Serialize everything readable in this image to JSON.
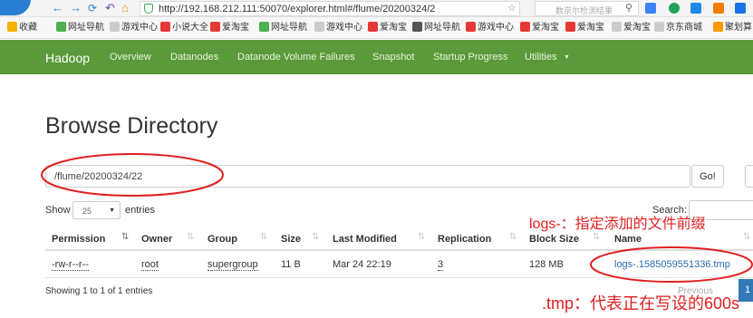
{
  "browser": {
    "url": "http://192.168.212.111:50070/explorer.html#/flume/20200324/2",
    "url_host": "192.168.212.111",
    "search_placeholder": "数京尔检测结果"
  },
  "bookmarks": [
    {
      "label": "收藏",
      "color": "#f5b400"
    },
    {
      "label": "网址导航",
      "color": "#4caf50"
    },
    {
      "label": "游戏中心",
      "color": "#cccccc"
    },
    {
      "label": "小说大全",
      "color": "#e53935"
    },
    {
      "label": "爱淘宝",
      "color": "#e53935"
    },
    {
      "label": "网址导航",
      "color": "#4caf50"
    },
    {
      "label": "游戏中心",
      "color": "#cccccc"
    },
    {
      "label": "爱淘宝",
      "color": "#e53935"
    },
    {
      "label": "网址导航",
      "color": "#555555"
    },
    {
      "label": "游戏中心",
      "color": "#e53935"
    },
    {
      "label": "爱淘宝",
      "color": "#e53935"
    },
    {
      "label": "爱淘宝",
      "color": "#e53935"
    },
    {
      "label": "爱淘宝",
      "color": "#cccccc"
    },
    {
      "label": "京东商城",
      "color": "#cccccc"
    },
    {
      "label": "聚划算",
      "color": "#ff9800"
    }
  ],
  "navbar": {
    "brand": "Hadoop",
    "items": [
      "Overview",
      "Datanodes",
      "Datanode Volume Failures",
      "Snapshot",
      "Startup Progress",
      "Utilities"
    ],
    "color": "#5a9a3a"
  },
  "page": {
    "title": "Browse Directory",
    "path": "/flume/20200324/22",
    "go_label": "Go!",
    "show_label": "Show",
    "entries_value": "25",
    "entries_label": "entries",
    "search_label": "Search:"
  },
  "table": {
    "columns": [
      "Permission",
      "Owner",
      "Group",
      "Size",
      "Last Modified",
      "Replication",
      "Block Size",
      "Name"
    ],
    "rows": [
      {
        "permission": "-rw-r--r--",
        "owner": "root",
        "group": "supergroup",
        "size": "11 B",
        "last_modified": "Mar 24 22:19",
        "replication": "3",
        "block_size": "128 MB",
        "name": "logs-.1585059551336.tmp"
      }
    ]
  },
  "footer": {
    "showing": "Showing 1 to 1 of 1 entries",
    "previous_label": "Previous",
    "page_number": "1"
  },
  "annotations": {
    "logs_note": "logs-：指定添加的文件前缀",
    "tmp_note": ".tmp：代表正在写设的600s",
    "color": "#e02020"
  }
}
